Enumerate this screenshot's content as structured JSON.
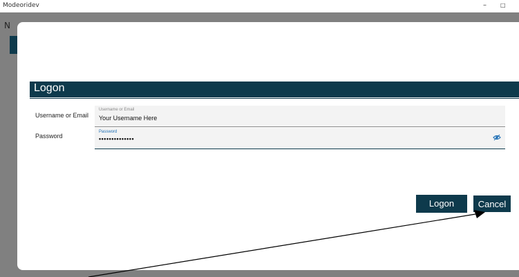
{
  "window": {
    "title": "Modeoridev",
    "minimize_glyph": "–",
    "restore_glyph": "□"
  },
  "background": {
    "partial_letter": "N"
  },
  "dialog": {
    "header_title": "Logon",
    "username": {
      "label": "Username or Email",
      "float_label": "Username or Email",
      "value": "Your Username Here"
    },
    "password": {
      "label": "Password",
      "float_label": "Password",
      "value": "••••••••••••••",
      "reveal_icon": "eye-icon"
    },
    "buttons": {
      "logon": "Logon",
      "cancel": "Cancel"
    }
  },
  "colors": {
    "header": "#0e3a4c",
    "focus_label": "#1f6fb5",
    "backdrop": "#808080"
  }
}
